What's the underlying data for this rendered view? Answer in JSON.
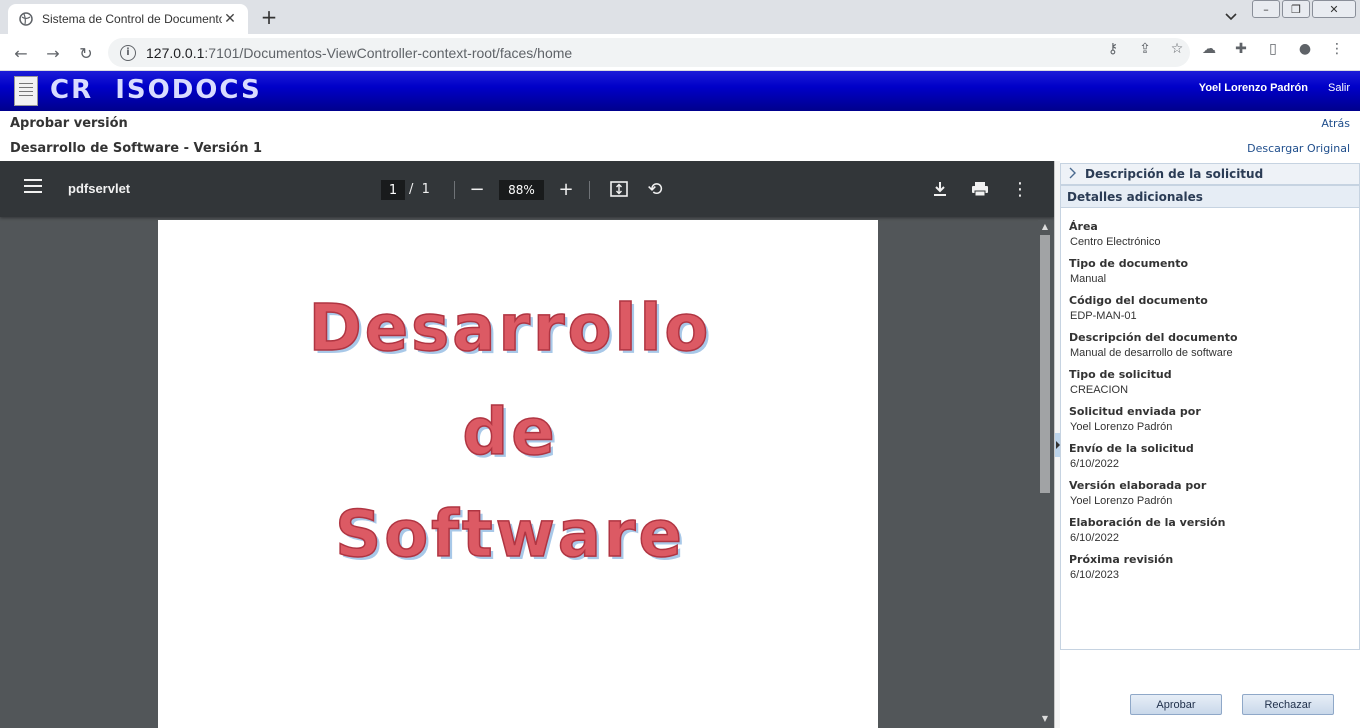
{
  "browser": {
    "tab_title": "Sistema de Control de Documento",
    "url_host": "127.0.0.1",
    "url_rest": ":7101/Documentos-ViewController-context-root/faces/home"
  },
  "app": {
    "logo_text": "CR  ISODOCS",
    "user_name": "Yoel Lorenzo Padrón",
    "logout_label": "Salir"
  },
  "page": {
    "title": "Aprobar versión",
    "back_label": "Atrás",
    "document_title": "Desarrollo de Software - Versión 1",
    "download_original_label": "Descargar Original"
  },
  "pdf_viewer": {
    "file_name": "pdfservlet",
    "current_page": "1",
    "page_separator": "/",
    "total_pages": "1",
    "zoom": "88%",
    "page_content": [
      "Desarrollo",
      "de",
      "Software"
    ]
  },
  "side_panel": {
    "section_collapsed_label": "Descripción de la solicitud",
    "section_open_label": "Detalles adicionales",
    "fields": [
      {
        "label": "Área",
        "value": "Centro Electrónico"
      },
      {
        "label": "Tipo de documento",
        "value": "Manual"
      },
      {
        "label": "Código del documento",
        "value": "EDP-MAN-01"
      },
      {
        "label": "Descripción del documento",
        "value": "Manual de desarrollo de software"
      },
      {
        "label": "Tipo de solicitud",
        "value": "CREACION"
      },
      {
        "label": "Solicitud enviada por",
        "value": "Yoel Lorenzo Padrón"
      },
      {
        "label": "Envío de la solicitud",
        "value": "6/10/2022"
      },
      {
        "label": "Versión elaborada por",
        "value": "Yoel Lorenzo Padrón"
      },
      {
        "label": "Elaboración de la versión",
        "value": "6/10/2022"
      },
      {
        "label": "Próxima revisión",
        "value": "6/10/2023"
      }
    ],
    "approve_label": "Aprobar",
    "reject_label": "Rechazar"
  },
  "colors": {
    "app_header": "#0000c8",
    "pdf_toolbar": "#323639",
    "pdf_background": "#525659",
    "link": "#1f4e8c"
  }
}
